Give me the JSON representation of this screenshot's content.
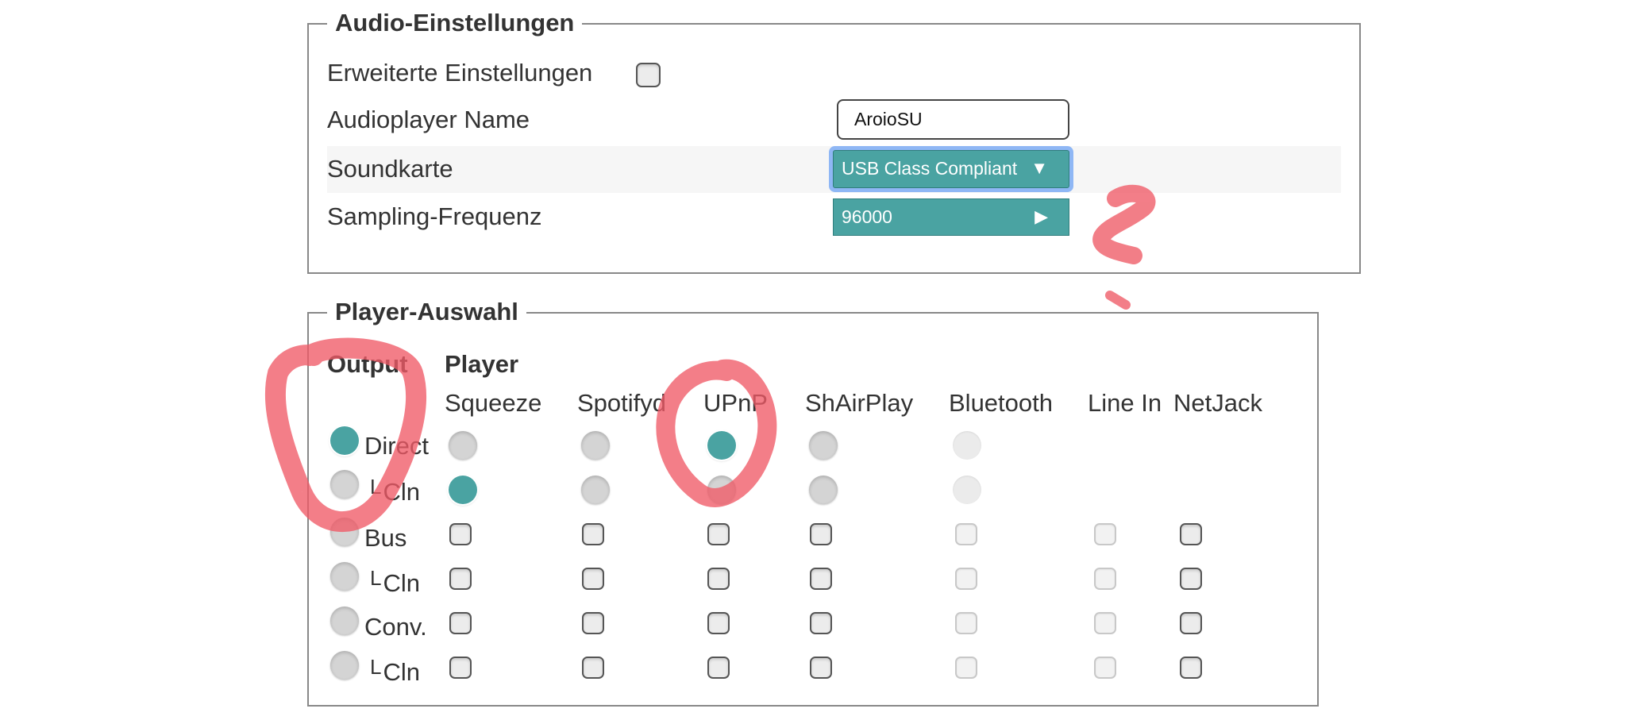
{
  "audio_settings": {
    "legend": "Audio-Einstellungen",
    "advanced_label": "Erweiterte Einstellungen",
    "player_name_label": "Audioplayer Name",
    "player_name_value": "AroioSU",
    "soundcard_label": "Soundkarte",
    "soundcard_value": "USB Class Compliant",
    "sampling_label": "Sampling-Frequenz",
    "sampling_value": "96000",
    "soundcard_caret": "▼",
    "sampling_caret": "▶"
  },
  "player_selection": {
    "legend": "Player-Auswahl",
    "output_header": "Output",
    "player_header": "Player",
    "players": [
      "Squeeze",
      "Spotifyd",
      "UPnP",
      "ShAirPlay",
      "Bluetooth",
      "Line In",
      "NetJack"
    ],
    "rows": [
      {
        "label": "Direct",
        "prefix": ""
      },
      {
        "label": "Cln",
        "prefix": "L"
      },
      {
        "label": "Bus",
        "prefix": ""
      },
      {
        "label": "Cln",
        "prefix": "L"
      },
      {
        "label": "Conv.",
        "prefix": ""
      },
      {
        "label": "Cln",
        "prefix": "L"
      }
    ],
    "selected_output": "Direct",
    "selected_players": {
      "Direct": "UPnP",
      "Cln": "Squeeze"
    }
  },
  "colors": {
    "accent": "#4aa3a2",
    "focus_ring": "#8fb7f5",
    "annotation": "#ef5a66"
  }
}
